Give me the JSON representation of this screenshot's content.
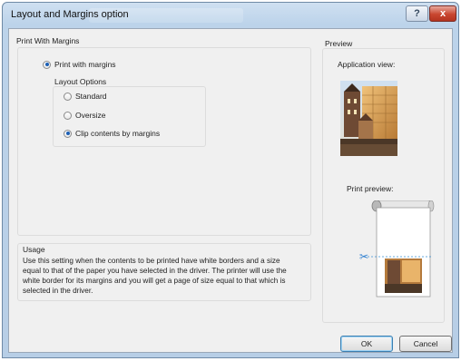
{
  "window": {
    "title": "Layout and Margins option"
  },
  "titlebar": {
    "help_glyph": "?",
    "close_glyph": "x"
  },
  "print_group": {
    "title": "Print With Margins",
    "print_with_margins": {
      "label": "Print with margins",
      "checked": true
    }
  },
  "layout_options": {
    "title": "Layout Options",
    "options": [
      {
        "label": "Standard",
        "checked": false
      },
      {
        "label": "Oversize",
        "checked": false
      },
      {
        "label": "Clip contents by margins",
        "checked": true
      }
    ]
  },
  "usage": {
    "title": "Usage",
    "text": "Use this setting when the contents to be printed have white borders and a size equal to that of the paper you have selected in the driver. The printer will use the white border for its margins and you will get a page of size equal to that which is selected in the driver."
  },
  "preview": {
    "title": "Preview",
    "application_view_label": "Application view:",
    "print_preview_label": "Print preview:",
    "scissors_icon": "scissors-icon"
  },
  "buttons": {
    "ok": "OK",
    "cancel": "Cancel"
  },
  "colors": {
    "accent": "#1c5fb5",
    "window_frame": "#bcd3ea",
    "close": "#c9462f"
  }
}
